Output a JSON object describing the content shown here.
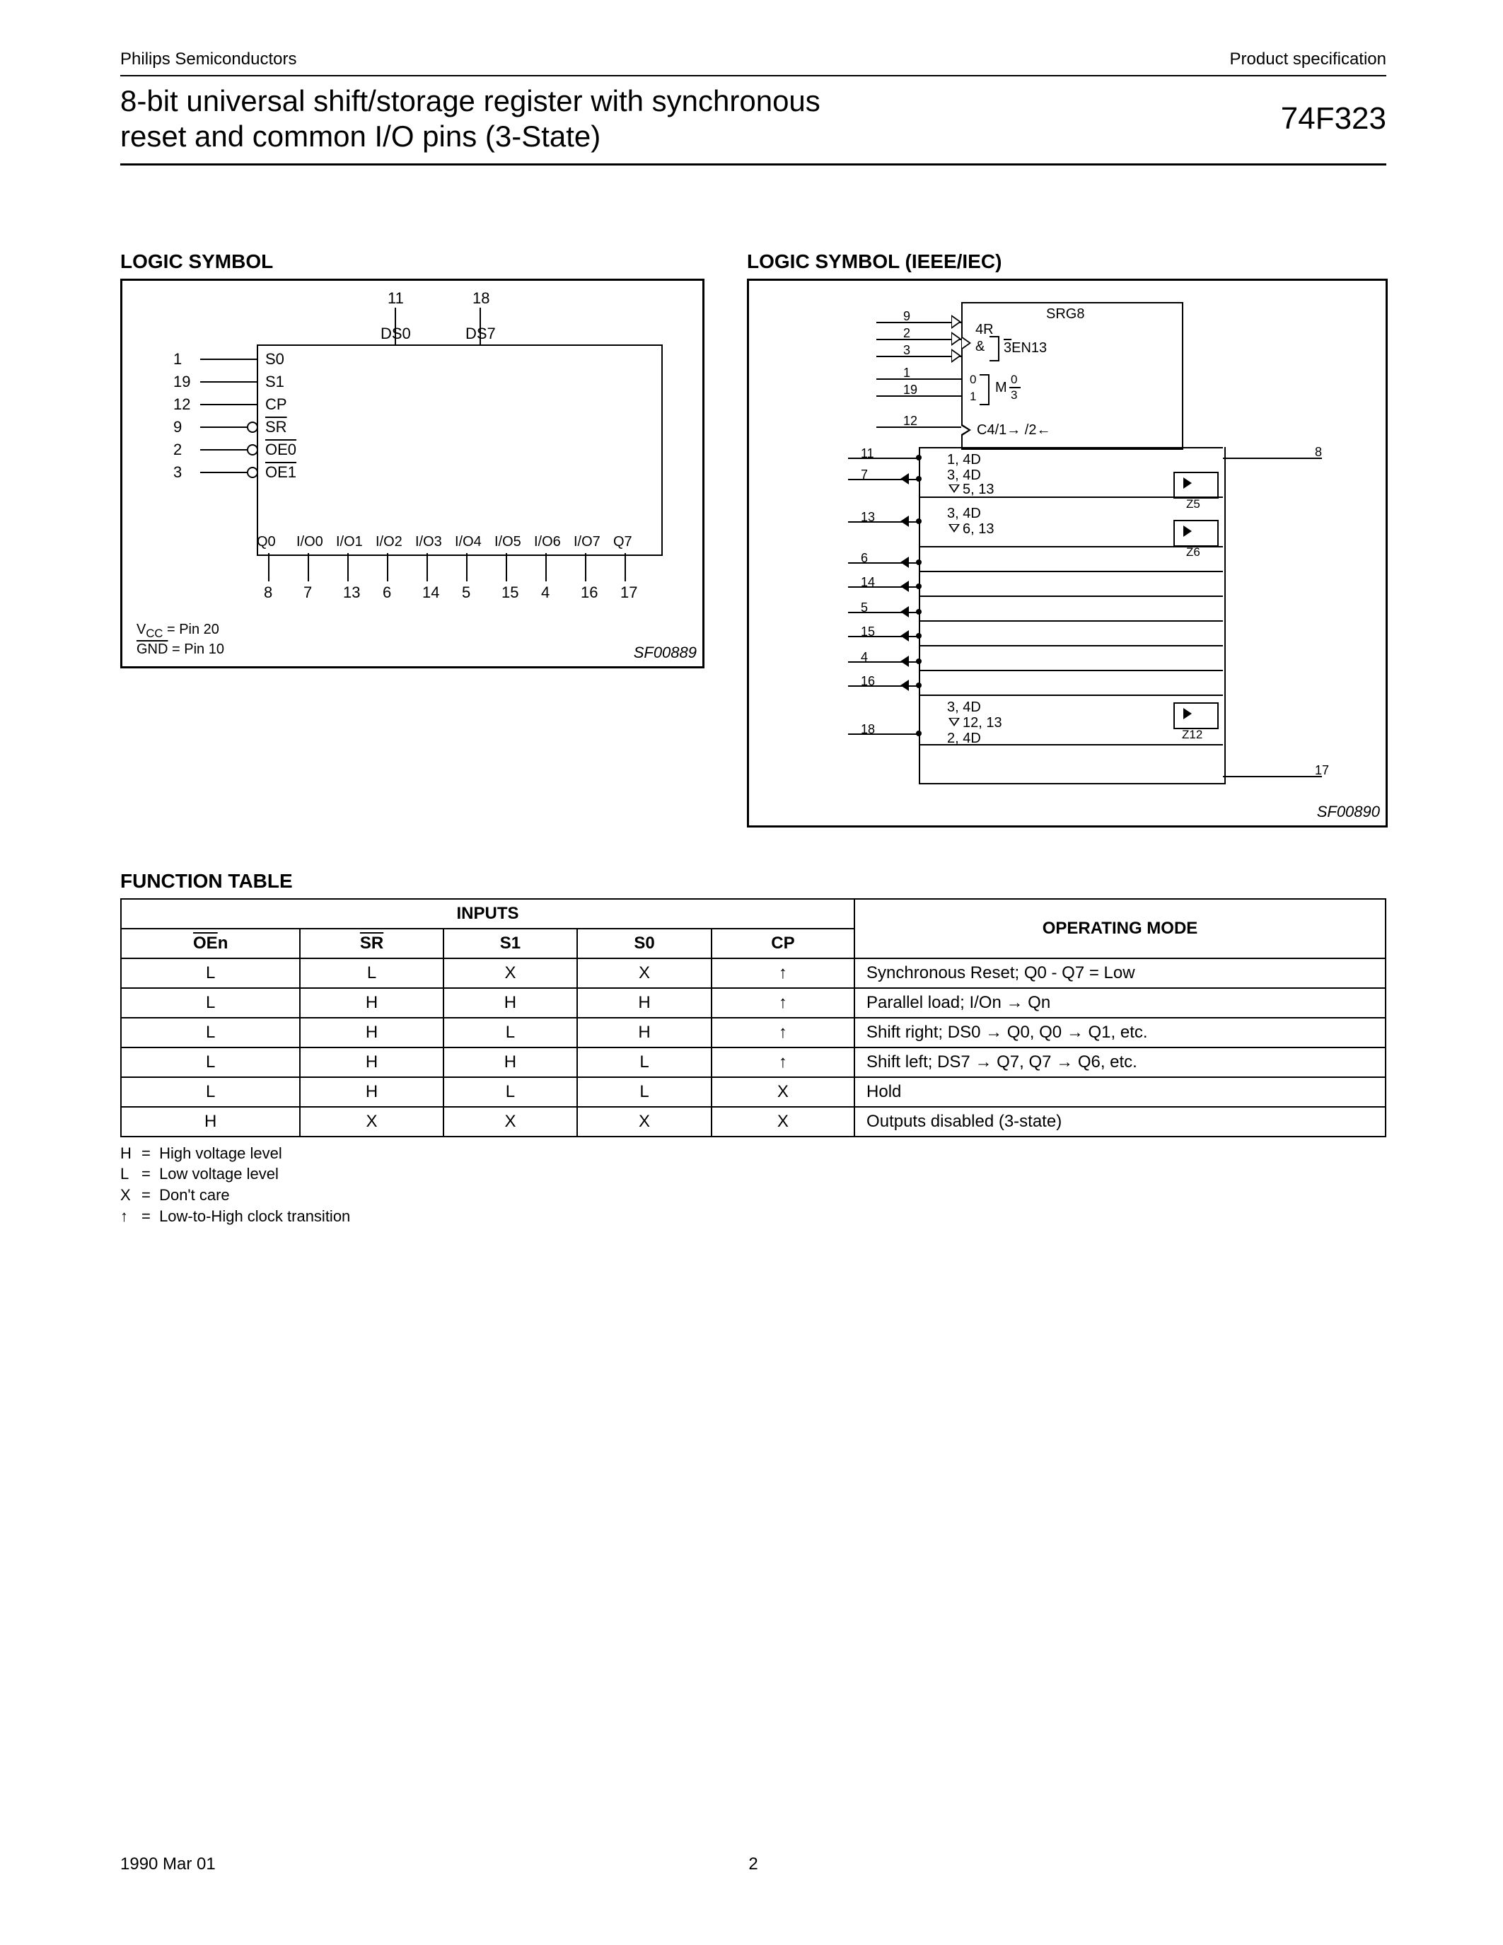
{
  "header": {
    "company": "Philips Semiconductors",
    "doc_type": "Product specification",
    "title_l1": "8-bit universal shift/storage register with synchronous",
    "title_l2": "reset and common I/O pins (3-State)",
    "part": "74F323"
  },
  "sections": {
    "logic_symbol": "LOGIC SYMBOL",
    "ieee": "LOGIC SYMBOL (IEEE/IEC)",
    "function_table": "FUNCTION TABLE"
  },
  "logic_symbol": {
    "sf": "SF00889",
    "top_pins": [
      {
        "num": "11",
        "label": "DS0"
      },
      {
        "num": "18",
        "label": "DS7"
      }
    ],
    "left_pins": [
      {
        "num": "1",
        "label": "S0",
        "bubble": false
      },
      {
        "num": "19",
        "label": "S1",
        "bubble": false
      },
      {
        "num": "12",
        "label": "CP",
        "bubble": false
      },
      {
        "num": "9",
        "label": "SR",
        "bubble": true,
        "overbar": true
      },
      {
        "num": "2",
        "label": "OE0",
        "bubble": true,
        "overbar": true
      },
      {
        "num": "3",
        "label": "OE1",
        "bubble": true,
        "overbar": true
      }
    ],
    "bottom_labels": [
      "Q0",
      "I/O0",
      "I/O1",
      "I/O2",
      "I/O3",
      "I/O4",
      "I/O5",
      "I/O6",
      "I/O7",
      "Q7"
    ],
    "bottom_pins": [
      "8",
      "7",
      "13",
      "6",
      "14",
      "5",
      "15",
      "4",
      "16",
      "17"
    ],
    "vcc": "V_CC = Pin 20",
    "gnd": "GND = Pin 10"
  },
  "ieee_symbol": {
    "sf": "SF00890",
    "srg": "SRG8",
    "r4": "4R",
    "amp": "&",
    "en": "3EN13",
    "m": "M",
    "mfrac_top": "0",
    "mfrac_bot": "3",
    "clk": "C4/1→ /2←",
    "top_left_pins": [
      "9",
      "2",
      "3",
      "1",
      "19",
      "12"
    ],
    "body_left_pins": [
      "11",
      "7",
      "13",
      "6",
      "14",
      "5",
      "15",
      "4",
      "16",
      "18"
    ],
    "right_pin_top": "8",
    "right_pin_bot": "17",
    "cell_first": [
      "1, 4D",
      "3, 4D",
      "▽ 5, 13"
    ],
    "cell_second": [
      "3, 4D",
      "▽ 6, 13"
    ],
    "cell_last": [
      "3, 4D",
      "▽ 12, 13",
      "2, 4D"
    ],
    "z5": "Z5",
    "z6": "Z6",
    "z12": "Z12",
    "m0": "0",
    "m1": "1"
  },
  "function_table": {
    "head_inputs": "INPUTS",
    "head_mode": "OPERATING MODE",
    "cols": [
      "OEn",
      "SR",
      "S1",
      "S0",
      "CP"
    ],
    "rows": [
      {
        "c": [
          "L",
          "L",
          "X",
          "X",
          "↑"
        ],
        "mode": "Synchronous Reset; Q0 - Q7 = Low"
      },
      {
        "c": [
          "L",
          "H",
          "H",
          "H",
          "↑"
        ],
        "mode": "Parallel load; I/On → Qn"
      },
      {
        "c": [
          "L",
          "H",
          "L",
          "H",
          "↑"
        ],
        "mode": "Shift right; DS0 → Q0, Q0 → Q1, etc."
      },
      {
        "c": [
          "L",
          "H",
          "H",
          "L",
          "↑"
        ],
        "mode": "Shift left; DS7  → Q7, Q7  → Q6, etc."
      },
      {
        "c": [
          "L",
          "H",
          "L",
          "L",
          "X"
        ],
        "mode": "Hold"
      },
      {
        "c": [
          "H",
          "X",
          "X",
          "X",
          "X"
        ],
        "mode": "Outputs disabled (3-state)"
      }
    ],
    "legend": [
      {
        "k": "H",
        "v": "High voltage level"
      },
      {
        "k": "L",
        "v": "Low voltage level"
      },
      {
        "k": "X",
        "v": "Don't care"
      },
      {
        "k": "↑",
        "v": "Low-to-High clock transition"
      }
    ]
  },
  "footer": {
    "date": "1990 Mar 01",
    "page": "2"
  }
}
